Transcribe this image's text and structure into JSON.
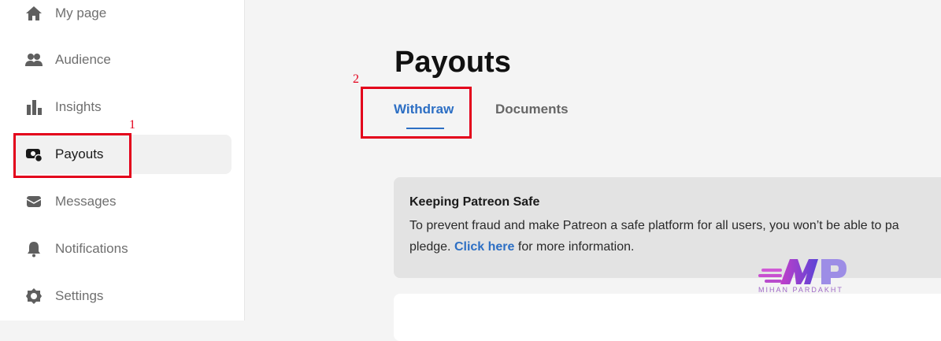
{
  "sidebar": {
    "items": [
      {
        "label": "My page",
        "icon": "home-icon"
      },
      {
        "label": "Audience",
        "icon": "people-icon"
      },
      {
        "label": "Insights",
        "icon": "bar-chart-icon"
      },
      {
        "label": "Payouts",
        "icon": "payouts-icon"
      },
      {
        "label": "Messages",
        "icon": "envelope-icon"
      },
      {
        "label": "Notifications",
        "icon": "bell-icon"
      },
      {
        "label": "Settings",
        "icon": "gear-icon"
      }
    ],
    "active_index": 3
  },
  "annotations": {
    "step1": "1",
    "step2": "2"
  },
  "main": {
    "title": "Payouts",
    "tabs": [
      {
        "label": "Withdraw",
        "active": true
      },
      {
        "label": "Documents",
        "active": false
      }
    ],
    "notice": {
      "title": "Keeping Patreon Safe",
      "line1": "To prevent fraud and make Patreon a safe platform for all users, you won’t be able to pa",
      "line2_before": "pledge. ",
      "link": "Click here",
      "line2_after": " for more information."
    }
  },
  "watermark": {
    "letters": "MP",
    "text": "MIHAN PARDAKHT"
  },
  "colors": {
    "accent": "#2d6fc4",
    "annotation": "#e3001b",
    "icon": "#5f5f5f"
  }
}
